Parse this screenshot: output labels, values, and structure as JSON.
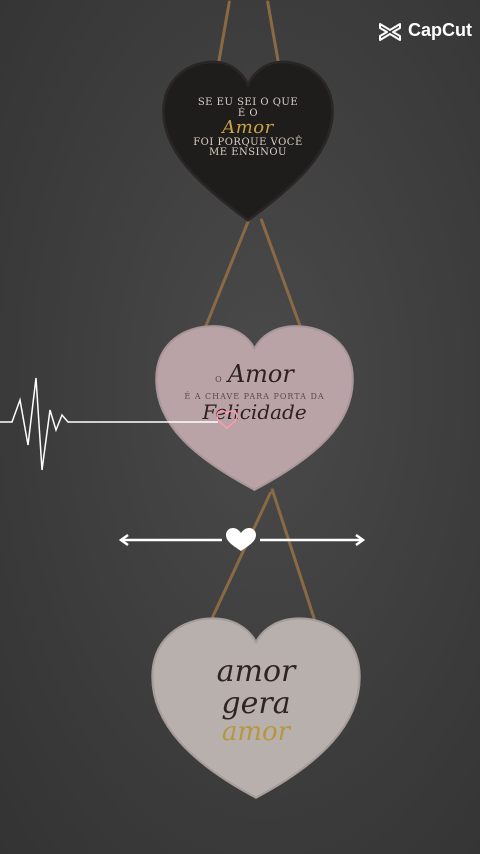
{
  "watermark": {
    "brand": "CapCut",
    "icon": "capcut-logo-icon"
  },
  "hearts": [
    {
      "lines": [
        "SE EU SEI O QUE",
        "É O"
      ],
      "highlight": "Amor",
      "tail": [
        "FOI PORQUE VOCÊ",
        "ME ENSINOU"
      ]
    },
    {
      "prefix": "O",
      "highlight": "Amor",
      "lines": [
        "É A CHAVE PARA PORTA DA"
      ],
      "tail": "Felicidade"
    },
    {
      "lines": [
        "amor",
        "gera"
      ],
      "highlight": "amor"
    }
  ],
  "decor": {
    "pulse_icon": "heartbeat-line-icon",
    "divider_icon": "heart-divider-icon"
  },
  "colors": {
    "background": "#3e3e3e",
    "dark_heart": "#1f1c1c",
    "pink_heart": "#b9a3a6",
    "cream_heart": "#b8b0ad",
    "gold": "#c9a24a"
  }
}
